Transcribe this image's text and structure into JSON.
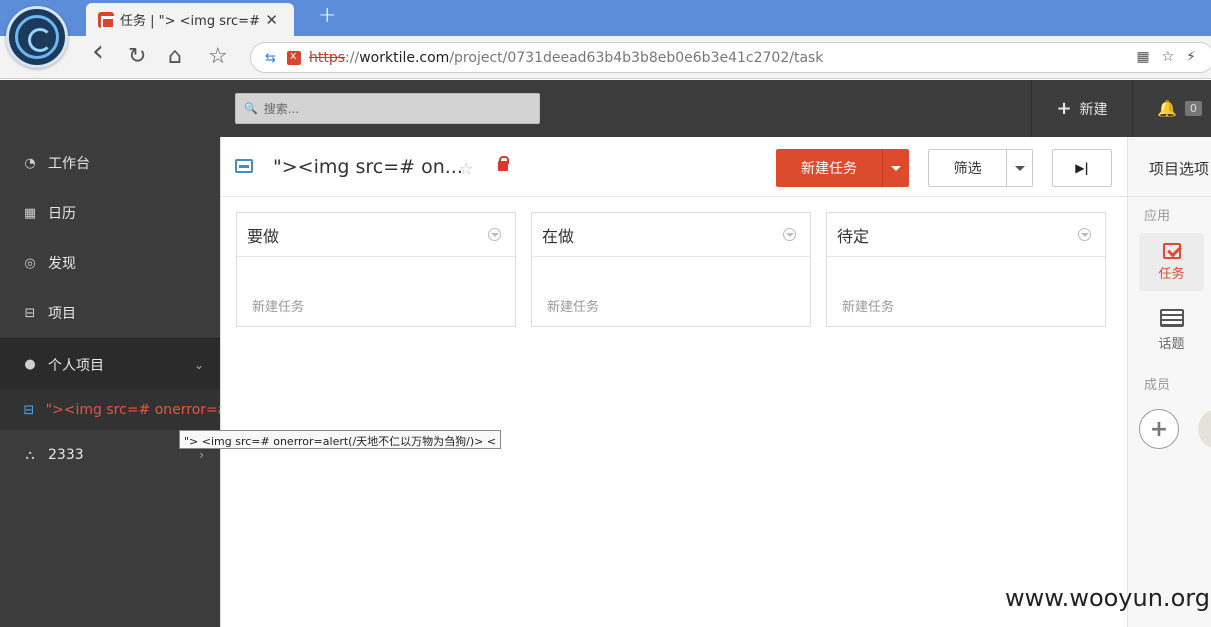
{
  "browser": {
    "tab_title": "任务 | \"> <img src=# one",
    "tab_close": "✕",
    "new_tab": "+",
    "url_scheme": "https",
    "url_sep": "://",
    "url_host": "worktile.com",
    "url_path": "/project/0731deead63b4b3b8eb0e6b3e41c2702/task",
    "nav": {
      "back": "‹",
      "reload": "↻",
      "home": "⌂",
      "bookmark": "☆"
    }
  },
  "topbar": {
    "search_placeholder": "搜索...",
    "new_label": "新建",
    "notifications_count": "0"
  },
  "sidebar": {
    "items": [
      {
        "label": "工作台",
        "icon": "dashboard-icon"
      },
      {
        "label": "日历",
        "icon": "calendar-icon"
      },
      {
        "label": "发现",
        "icon": "compass-icon"
      },
      {
        "label": "项目",
        "icon": "inbox-icon"
      }
    ],
    "group_label": "个人项目",
    "active_project": "\"><img src=# onerror=al...",
    "project_2333": "2333",
    "tooltip": "\"> <img src=# onerror=alert(/天地不仁以万物为刍狗/)> <"
  },
  "project": {
    "title": "\"><img src=# on...",
    "new_task_button": "新建任务",
    "filter_button": "筛选"
  },
  "columns": [
    {
      "title": "要做",
      "add_label": "新建任务"
    },
    {
      "title": "在做",
      "add_label": "新建任务"
    },
    {
      "title": "待定",
      "add_label": "新建任务"
    }
  ],
  "right_panel": {
    "title": "项目选项",
    "apps_label": "应用",
    "task_label": "任务",
    "topic_label": "话题",
    "members_label": "成员"
  },
  "watermark": "www.wooyun.org",
  "colors": {
    "accent": "#dd4b2f",
    "sidebar_bg": "#3c3c3c",
    "active_link": "#e8553e"
  }
}
